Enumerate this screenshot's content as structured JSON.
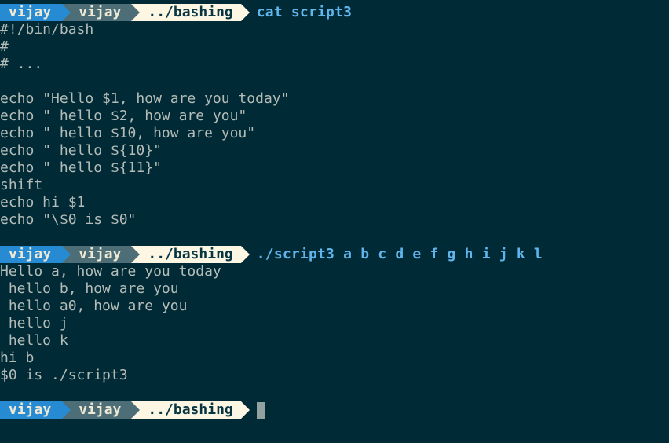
{
  "prompt": {
    "user": "vijay",
    "host": "vijay",
    "path": "../bashing"
  },
  "commands": {
    "cmd1": "cat script3",
    "cmd2": "./script3 a b c d e f g h i j k l"
  },
  "file_lines": [
    "#!/bin/bash",
    "#",
    "# ...",
    "",
    "echo \"Hello $1, how are you today\"",
    "echo \" hello $2, how are you\"",
    "echo \" hello $10, how are you\"",
    "echo \" hello ${10}\"",
    "echo \" hello ${11}\"",
    "shift",
    "echo hi $1",
    "echo \"\\$0 is $0\""
  ],
  "output_lines": [
    "Hello a, how are you today",
    " hello b, how are you",
    " hello a0, how are you",
    " hello j",
    " hello k",
    "hi b",
    "$0 is ./script3"
  ],
  "colors": {
    "background": "#002b36",
    "user_segment": "#268bd2",
    "host_segment": "#4d6e76",
    "path_segment": "#fdf6e3",
    "command_text": "#5fb5ec",
    "output_text": "#b5bcb8",
    "cursor": "#93a1a1"
  }
}
